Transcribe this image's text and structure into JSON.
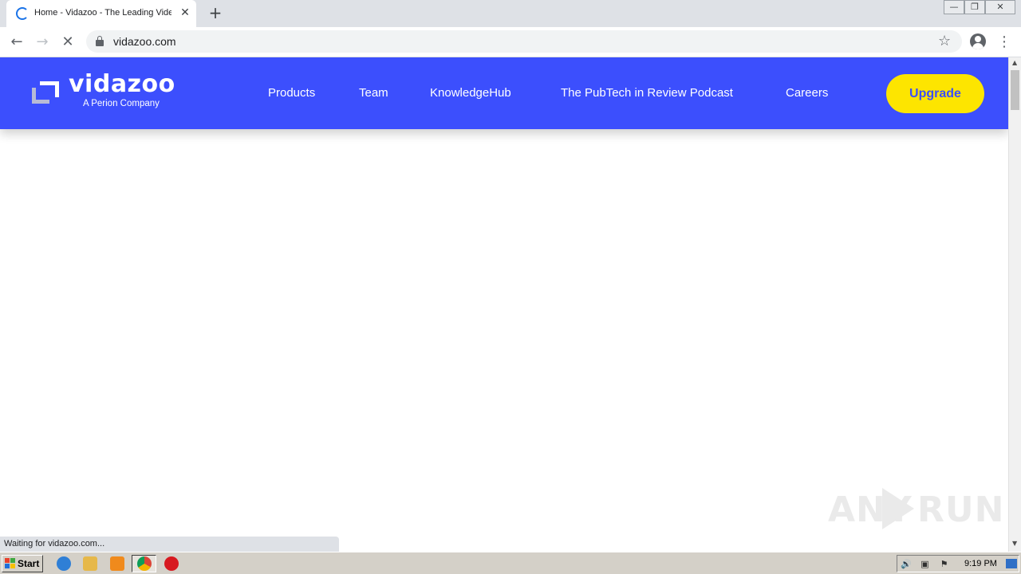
{
  "browser": {
    "tab": {
      "title": "Home - Vidazoo - The Leading Video Technology Platform",
      "close_glyph": "✕"
    },
    "new_tab_glyph": "+",
    "window_controls": {
      "minimize": "—",
      "restore": "❐",
      "close": "✕"
    },
    "nav": {
      "back": "←",
      "forward": "→",
      "stop": "✕"
    },
    "address": {
      "url": "vidazoo.com"
    },
    "star_glyph": "☆",
    "menu_glyph": "⋮",
    "status_text": "Waiting for vidazoo.com..."
  },
  "site": {
    "logo": {
      "name": "vidazoo",
      "tagline": "A Perion Company"
    },
    "nav_items": [
      {
        "label": "Products"
      },
      {
        "label": "Team"
      },
      {
        "label": "KnowledgeHub"
      },
      {
        "label": "The PubTech in Review Podcast"
      },
      {
        "label": "Careers"
      }
    ],
    "cta": {
      "label": "Upgrade"
    },
    "colors": {
      "header": "#3c4ffd",
      "cta": "#fde500"
    }
  },
  "scrollbar": {
    "up": "▲",
    "down": "▼"
  },
  "watermark": {
    "left": "ANY",
    "right": "RUN"
  },
  "taskbar": {
    "start_label": "Start",
    "clock": "9:19 PM",
    "tray": {
      "volume": "🔊",
      "network": "▣",
      "flag": "⚑"
    }
  }
}
